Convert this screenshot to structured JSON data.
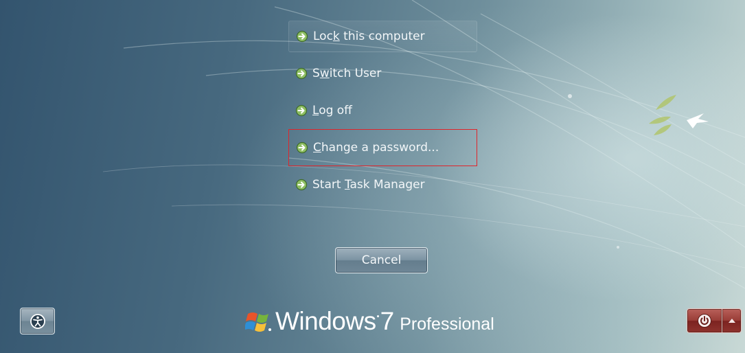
{
  "menu": {
    "items": [
      {
        "before": "Loc",
        "key": "k",
        "after": " this computer"
      },
      {
        "before": "S",
        "key": "w",
        "after": "itch User"
      },
      {
        "before": "",
        "key": "L",
        "after": "og off"
      },
      {
        "before": "",
        "key": "C",
        "after": "hange a password..."
      },
      {
        "before": "Start ",
        "key": "T",
        "after": "ask Manager"
      }
    ]
  },
  "cancel_label": "Cancel",
  "brand": {
    "name": "Windows",
    "version": "7",
    "edition": "Professional"
  },
  "icons": {
    "menu_arrow": "arrow-circle-right-icon",
    "ease_of_access": "ease-of-access-icon",
    "power": "power-icon",
    "power_options": "chevron-up-icon",
    "logo": "windows-flag-logo"
  },
  "colors": {
    "highlight_border": "#e0242a",
    "power_red": "#9a3e38"
  }
}
